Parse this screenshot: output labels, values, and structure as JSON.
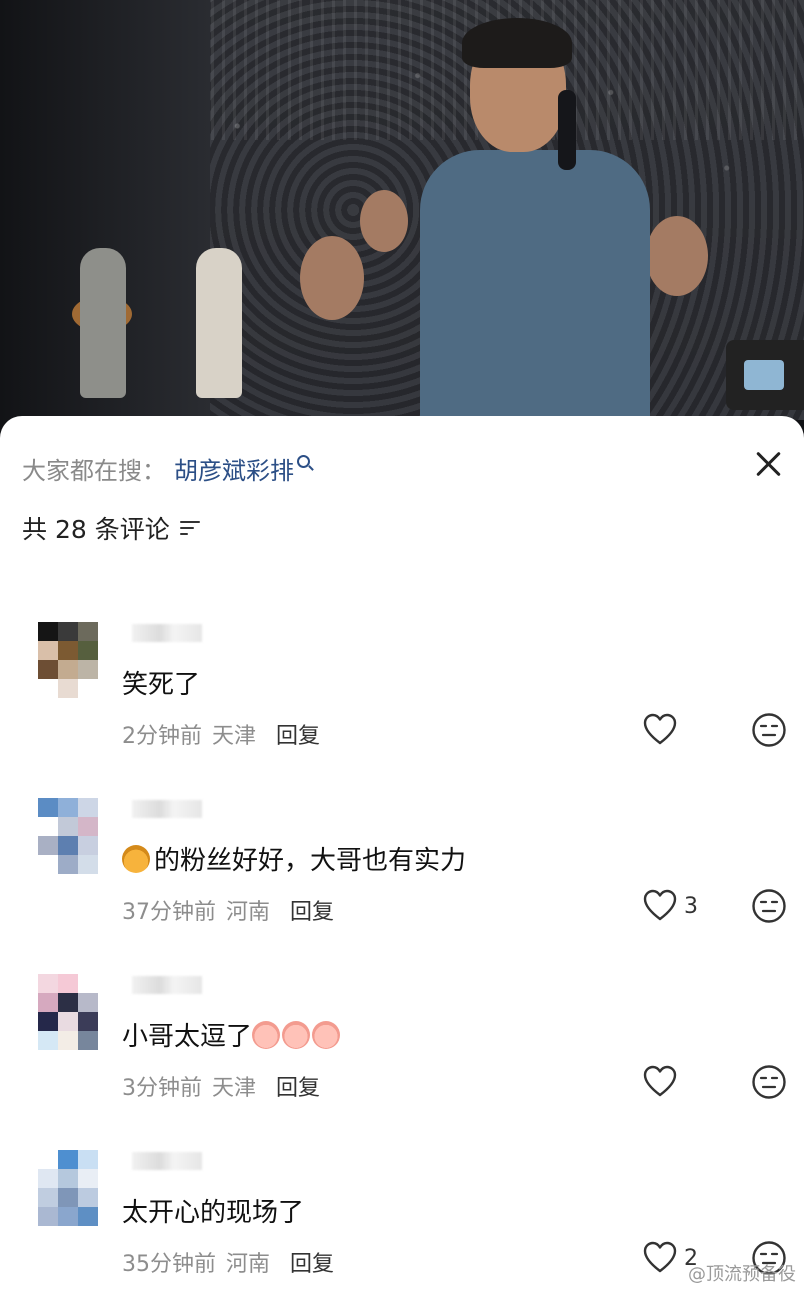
{
  "search": {
    "prefix": "大家都在搜：",
    "term": "胡彦斌彩排"
  },
  "comments_header": {
    "count_label": "共 28 条评论"
  },
  "comments": [
    {
      "text": "笑死了",
      "emoji": "",
      "time": "2分钟前",
      "location": "天津",
      "reply": "回复",
      "likes": ""
    },
    {
      "text": "的粉丝好好，大哥也有实力",
      "emoji": "tiger",
      "time": "37分钟前",
      "location": "河南",
      "reply": "回复",
      "likes": "3"
    },
    {
      "text": "小哥太逗了",
      "emoji": "cry",
      "time": "3分钟前",
      "location": "天津",
      "reply": "回复",
      "likes": ""
    },
    {
      "text": "太开心的现场了",
      "emoji": "",
      "time": "35分钟前",
      "location": "河南",
      "reply": "回复",
      "likes": "2"
    }
  ],
  "watermark": "@顶流预备役",
  "icons": {
    "close": "close-icon",
    "filter": "filter-icon",
    "like": "heart-icon",
    "react": "meh-face-icon",
    "search_hint": "search-icon"
  },
  "colors": {
    "accent_link": "#2c4f86",
    "muted_text": "#8d8d8d"
  }
}
